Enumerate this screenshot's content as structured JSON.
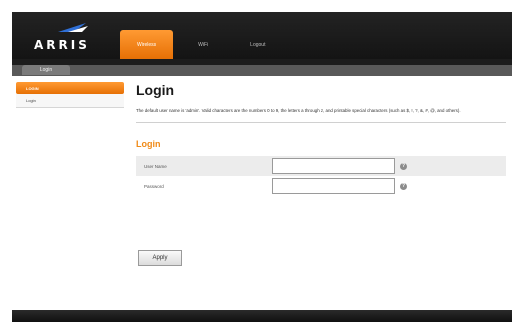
{
  "header": {
    "brand": "ARRIS",
    "nav": [
      {
        "label": "Wireless"
      },
      {
        "label": "WiFi"
      },
      {
        "label": "Logout"
      }
    ]
  },
  "subnav": {
    "tab": "Login"
  },
  "sidebar": {
    "items": [
      {
        "label": "LOGIN"
      },
      {
        "label": "Login"
      }
    ]
  },
  "main": {
    "title": "Login",
    "description": "The default user name is 'admin'. Valid characters are the numbers 0 to 9, the letters a through z, and printable special characters (such as $, !, ?, &, #, @, and others).",
    "section_title": "Login",
    "fields": [
      {
        "label": "User Name",
        "value": "",
        "help": "?"
      },
      {
        "label": "Password",
        "value": "",
        "help": "?"
      }
    ],
    "apply_label": "Apply"
  },
  "colors": {
    "accent": "#f08a17",
    "header_bg": "#1c1c1c"
  }
}
